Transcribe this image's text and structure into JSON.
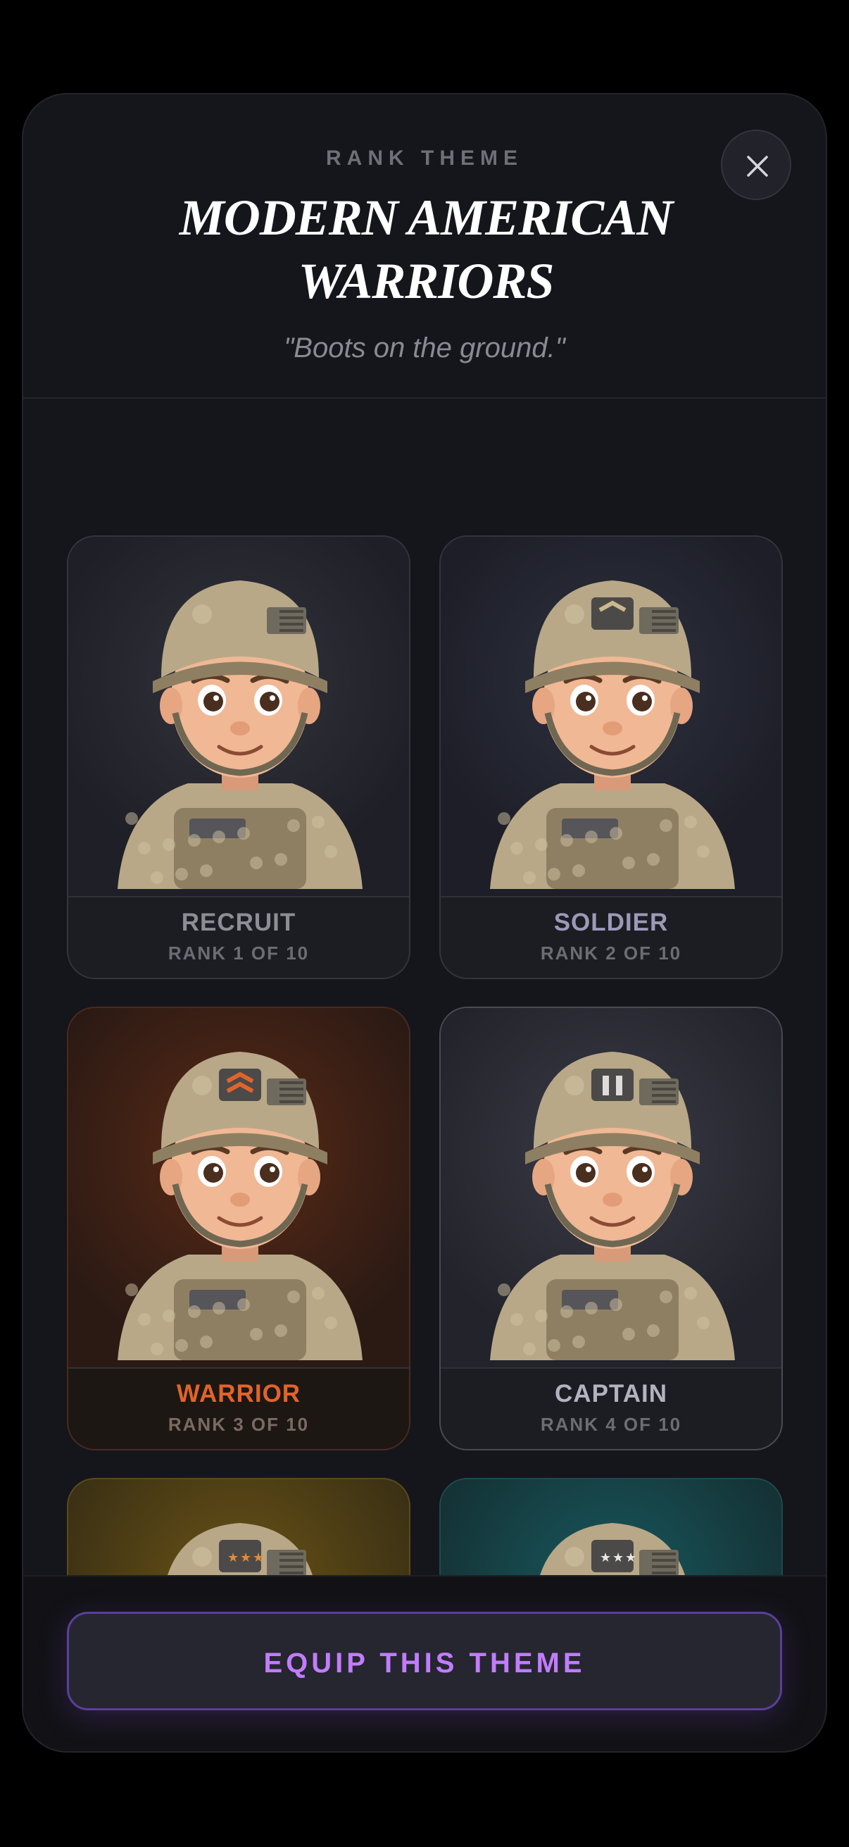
{
  "header": {
    "eyebrow": "RANK THEME",
    "title": "MODERN AMERICAN WARRIORS",
    "subtitle": "\"Boots on the ground.\"",
    "close_icon": "close-icon"
  },
  "ranks": [
    {
      "name": "RECRUIT",
      "rank": "RANK 1 OF 10",
      "insignia": "none"
    },
    {
      "name": "SOLDIER",
      "rank": "RANK 2 OF 10",
      "insignia": "chevron"
    },
    {
      "name": "WARRIOR",
      "rank": "RANK 3 OF 10",
      "insignia": "double-chevron",
      "accent": "#e0642c"
    },
    {
      "name": "CAPTAIN",
      "rank": "RANK 4 OF 10",
      "insignia": "bars"
    },
    {
      "name": "",
      "rank": "",
      "insignia": "three-stars",
      "accent": "#c9a227"
    },
    {
      "name": "",
      "rank": "",
      "insignia": "eagle-three-stars",
      "accent": "#2aa3a8"
    }
  ],
  "footer": {
    "equip_label": "EQUIP THIS THEME",
    "accent": "#c27cff"
  }
}
